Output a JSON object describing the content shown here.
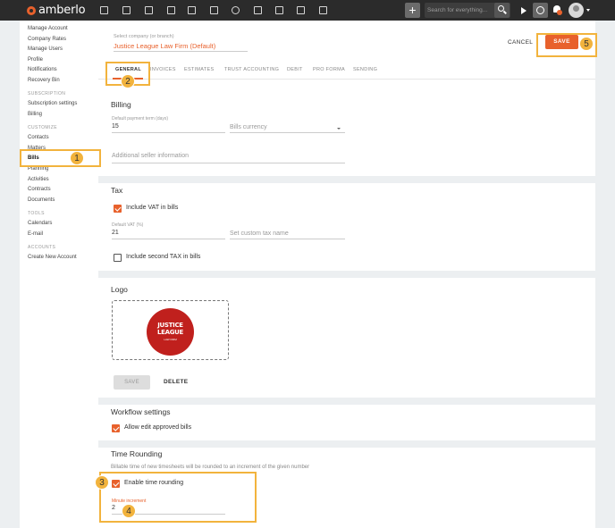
{
  "topbar": {
    "brand": "amberlo",
    "search_placeholder": "Search for everything...",
    "icons": [
      "dashboard-icon",
      "contacts-icon",
      "matters-icon",
      "documents-icon",
      "bank-icon",
      "calendar-icon",
      "history-icon",
      "folder-icon",
      "invoice-icon",
      "mail-icon",
      "reports-icon"
    ],
    "notification_count": "1"
  },
  "sidebar": {
    "items_top": [
      "Manage Account",
      "Company Rates",
      "Manage Users",
      "Profile",
      "Notifications",
      "Recovery Bin"
    ],
    "head_subscription": "SUBSCRIPTION",
    "items_subscription": [
      "Subscription settings",
      "Billing"
    ],
    "head_customize": "CUSTOMIZE",
    "items_customize": [
      "Contacts",
      "Matters",
      "Bills",
      "Planning",
      "Activities",
      "Contracts",
      "Documents"
    ],
    "head_tools": "TOOLS",
    "items_tools": [
      "Calendars",
      "E-mail"
    ],
    "head_accounts": "ACCOUNTS",
    "items_accounts": [
      "Create New Account"
    ]
  },
  "header": {
    "company_label": "Select company (or branch)",
    "company_value": "Justice League Law Firm (Default)",
    "cancel": "CANCEL",
    "save": "SAVE"
  },
  "tabs": [
    "GENERAL",
    "INVOICES",
    "ESTIMATES",
    "TRUST ACCOUNTING",
    "DEBIT",
    "PRO FORMA",
    "SENDING"
  ],
  "billing": {
    "title": "Billing",
    "payment_term_label": "Default payment term (days)",
    "payment_term_value": "15",
    "currency_placeholder": "Bills currency",
    "seller_info_placeholder": "Additional seller information"
  },
  "tax": {
    "title": "Tax",
    "include_vat": "Include VAT in bills",
    "default_vat_label": "Default VAT (%)",
    "default_vat_value": "21",
    "custom_tax_placeholder": "Set custom tax name",
    "second_tax": "Include second TAX in bills"
  },
  "logo": {
    "title": "Logo",
    "badge_line1": "JUSTICE",
    "badge_line2": "LEAGUE",
    "badge_line3": "LAW FIRM",
    "save": "SAVE",
    "delete": "DELETE"
  },
  "workflow": {
    "title": "Workflow settings",
    "allow_edit": "Allow edit approved bills"
  },
  "rounding": {
    "title": "Time Rounding",
    "hint": "Billable time of new timesheets will be rounded to an increment of the given number",
    "enable": "Enable time rounding",
    "minute_label": "Minute increment",
    "minute_value": "2"
  },
  "annotations": [
    "1",
    "2",
    "3",
    "4",
    "5"
  ],
  "colors": {
    "accent": "#e8612c",
    "highlight": "#f2b33d",
    "topbar": "#2b2b2b"
  }
}
